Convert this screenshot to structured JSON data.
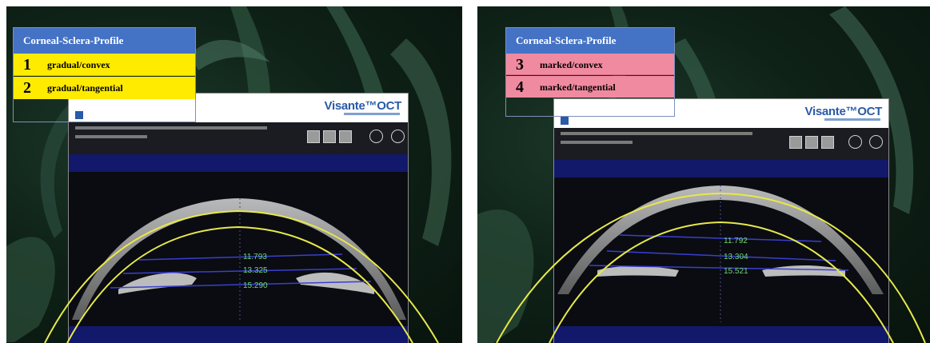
{
  "box_title": "Corneal-Sclera-Profile",
  "device_logo": "Visante™OCT",
  "left": {
    "rows": [
      {
        "num": "1",
        "label": "gradual/convex"
      },
      {
        "num": "2",
        "label": "gradual/tangential"
      }
    ],
    "row_color": "#ffeb00",
    "measurements": [
      "11.793",
      "13.325",
      "15.290"
    ]
  },
  "right": {
    "rows": [
      {
        "num": "3",
        "label": "marked/convex"
      },
      {
        "num": "4",
        "label": "marked/tangential"
      }
    ],
    "row_color": "#f08aa0",
    "measurements": [
      "11.792",
      "13.304",
      "15.521"
    ]
  },
  "colors": {
    "title_bg": "#4472c4",
    "arc": "#e8e84a",
    "measure_line": "#3a3fd0",
    "measure_text": "#6fd86f"
  }
}
